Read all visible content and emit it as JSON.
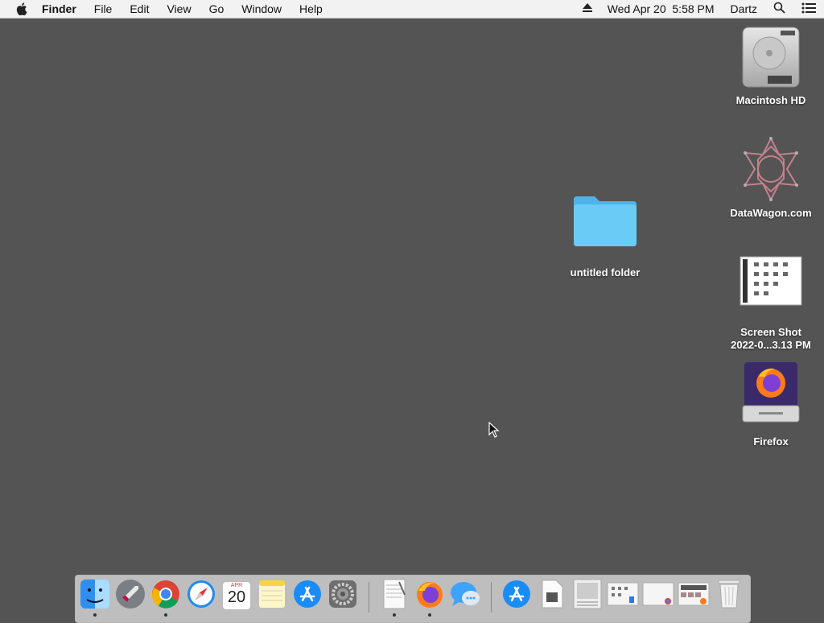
{
  "menubar": {
    "app_name": "Finder",
    "menus": [
      "File",
      "Edit",
      "View",
      "Go",
      "Window",
      "Help"
    ],
    "clock": "Wed Apr 20  5:58 PM",
    "user": "Dartz"
  },
  "desktop": {
    "icons": [
      {
        "label": "Macintosh HD",
        "icon": "hard-drive-icon"
      },
      {
        "label": "DataWagon.com",
        "icon": "datawagon-logo-icon"
      },
      {
        "label": "untitled folder",
        "icon": "folder-icon"
      },
      {
        "label_line1": "Screen Shot",
        "label_line2": "2022-0...3.13 PM",
        "icon": "screenshot-thumbnail-icon"
      },
      {
        "label": "Firefox",
        "icon": "firefox-disk-icon"
      }
    ]
  },
  "dock": {
    "items": [
      "Finder",
      "Launchpad",
      "Chrome",
      "Safari",
      "Calendar",
      "Notes",
      "App Store",
      "System Preferences",
      "TextEdit",
      "Firefox",
      "Messages",
      "Applications",
      "Documents",
      "Screenshot",
      "Screenshot 2",
      "Screenshot 3",
      "Screenshot 4",
      "Trash"
    ],
    "calendar_month": "APR",
    "calendar_day": "20"
  },
  "colors": {
    "desktop": "#545454",
    "folder": "#5ec3f5",
    "menubar": "#f2f2f2"
  }
}
